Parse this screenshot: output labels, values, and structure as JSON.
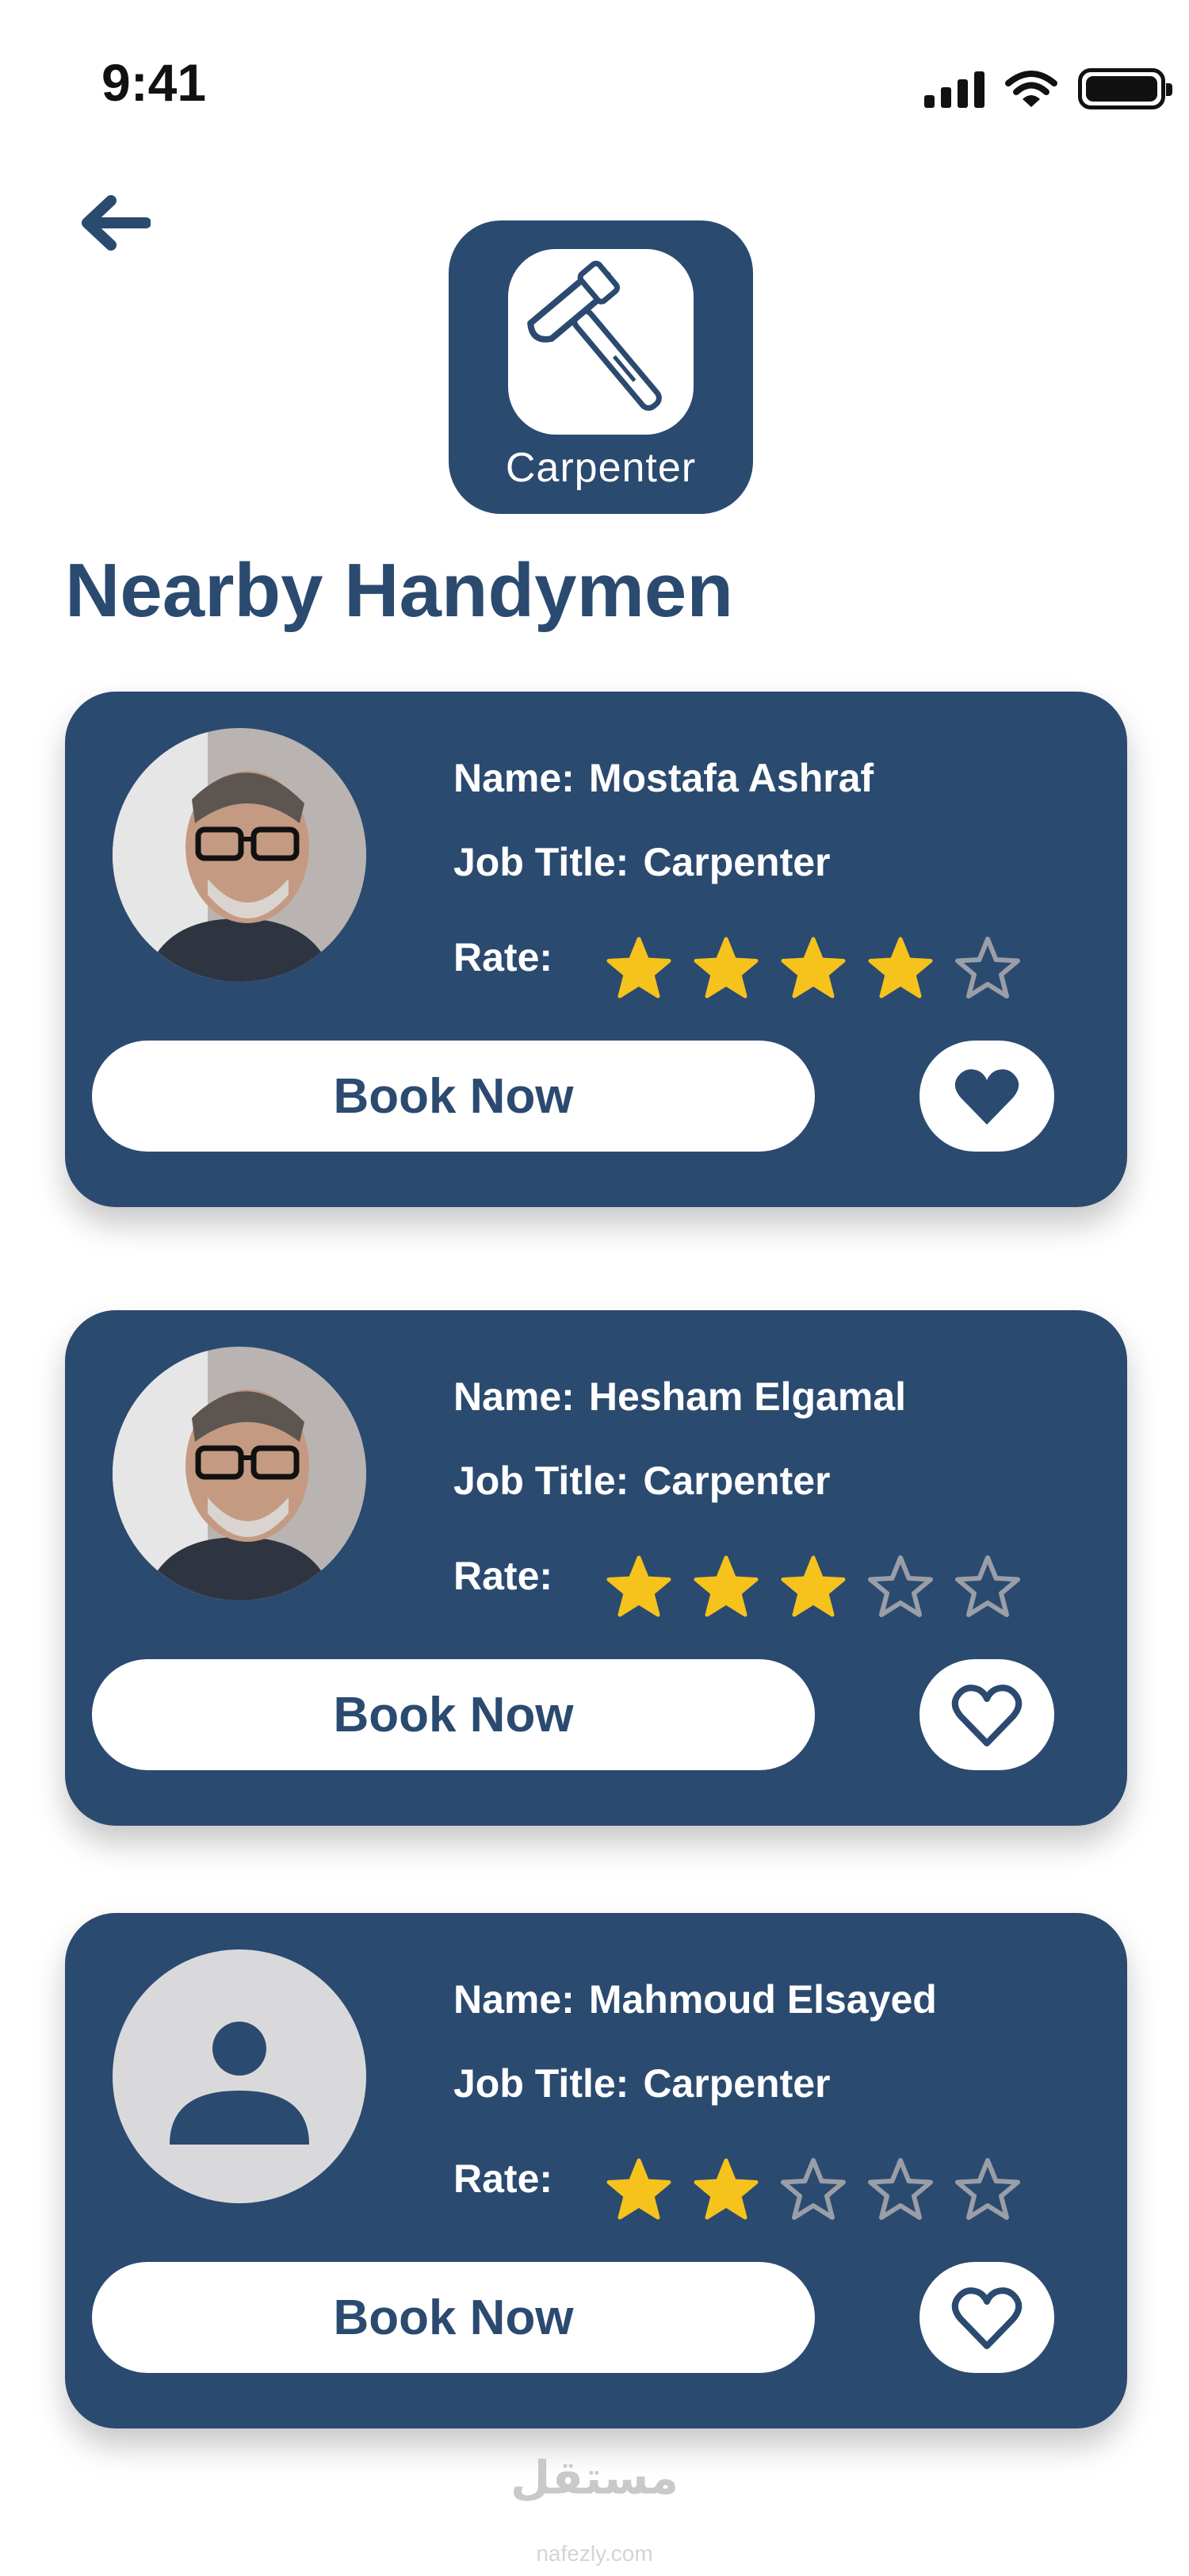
{
  "status_bar": {
    "time": "9:41"
  },
  "category": {
    "label": "Carpenter",
    "icon": "hammer-icon"
  },
  "section_title": "Nearby Handymen",
  "handymen": [
    {
      "name_key": "Name:",
      "name": "Mostafa Ashraf",
      "job_key": "Job Title:",
      "job": "Carpenter",
      "rate_key": "Rate:",
      "rating": 4,
      "max_rating": 5,
      "avatar": "photo",
      "favorited": true,
      "book_label": "Book Now"
    },
    {
      "name_key": "Name:",
      "name": "Hesham Elgamal",
      "job_key": "Job Title:",
      "job": "Carpenter",
      "rate_key": "Rate:",
      "rating": 3,
      "max_rating": 5,
      "avatar": "photo",
      "favorited": false,
      "book_label": "Book Now"
    },
    {
      "name_key": "Name:",
      "name": "Mahmoud Elsayed",
      "job_key": "Job Title:",
      "job": "Carpenter",
      "rate_key": "Rate:",
      "rating": 2,
      "max_rating": 5,
      "avatar": "placeholder",
      "favorited": false,
      "book_label": "Book Now"
    }
  ],
  "watermark": {
    "text": "مستقل",
    "sub": "nafezly.com"
  },
  "colors": {
    "primary": "#2b4a70",
    "star": "#f6c21c",
    "star_empty": "#9a9ea6",
    "placeholder": "#d9d9dc"
  }
}
